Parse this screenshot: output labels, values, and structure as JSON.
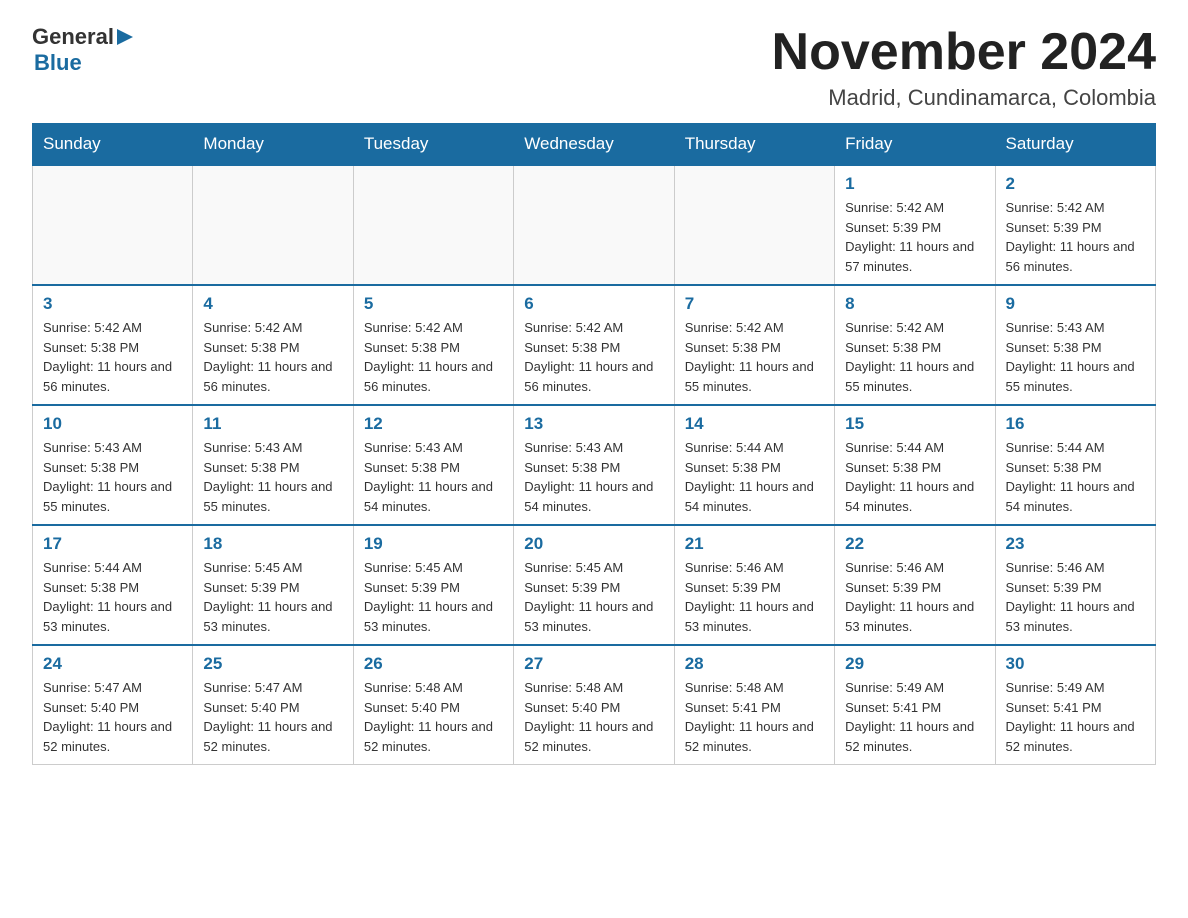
{
  "header": {
    "logo_general": "General",
    "logo_blue": "Blue",
    "title": "November 2024",
    "subtitle": "Madrid, Cundinamarca, Colombia"
  },
  "days_of_week": [
    "Sunday",
    "Monday",
    "Tuesday",
    "Wednesday",
    "Thursday",
    "Friday",
    "Saturday"
  ],
  "weeks": [
    [
      {
        "day": "",
        "info": ""
      },
      {
        "day": "",
        "info": ""
      },
      {
        "day": "",
        "info": ""
      },
      {
        "day": "",
        "info": ""
      },
      {
        "day": "",
        "info": ""
      },
      {
        "day": "1",
        "info": "Sunrise: 5:42 AM\nSunset: 5:39 PM\nDaylight: 11 hours and 57 minutes."
      },
      {
        "day": "2",
        "info": "Sunrise: 5:42 AM\nSunset: 5:39 PM\nDaylight: 11 hours and 56 minutes."
      }
    ],
    [
      {
        "day": "3",
        "info": "Sunrise: 5:42 AM\nSunset: 5:38 PM\nDaylight: 11 hours and 56 minutes."
      },
      {
        "day": "4",
        "info": "Sunrise: 5:42 AM\nSunset: 5:38 PM\nDaylight: 11 hours and 56 minutes."
      },
      {
        "day": "5",
        "info": "Sunrise: 5:42 AM\nSunset: 5:38 PM\nDaylight: 11 hours and 56 minutes."
      },
      {
        "day": "6",
        "info": "Sunrise: 5:42 AM\nSunset: 5:38 PM\nDaylight: 11 hours and 56 minutes."
      },
      {
        "day": "7",
        "info": "Sunrise: 5:42 AM\nSunset: 5:38 PM\nDaylight: 11 hours and 55 minutes."
      },
      {
        "day": "8",
        "info": "Sunrise: 5:42 AM\nSunset: 5:38 PM\nDaylight: 11 hours and 55 minutes."
      },
      {
        "day": "9",
        "info": "Sunrise: 5:43 AM\nSunset: 5:38 PM\nDaylight: 11 hours and 55 minutes."
      }
    ],
    [
      {
        "day": "10",
        "info": "Sunrise: 5:43 AM\nSunset: 5:38 PM\nDaylight: 11 hours and 55 minutes."
      },
      {
        "day": "11",
        "info": "Sunrise: 5:43 AM\nSunset: 5:38 PM\nDaylight: 11 hours and 55 minutes."
      },
      {
        "day": "12",
        "info": "Sunrise: 5:43 AM\nSunset: 5:38 PM\nDaylight: 11 hours and 54 minutes."
      },
      {
        "day": "13",
        "info": "Sunrise: 5:43 AM\nSunset: 5:38 PM\nDaylight: 11 hours and 54 minutes."
      },
      {
        "day": "14",
        "info": "Sunrise: 5:44 AM\nSunset: 5:38 PM\nDaylight: 11 hours and 54 minutes."
      },
      {
        "day": "15",
        "info": "Sunrise: 5:44 AM\nSunset: 5:38 PM\nDaylight: 11 hours and 54 minutes."
      },
      {
        "day": "16",
        "info": "Sunrise: 5:44 AM\nSunset: 5:38 PM\nDaylight: 11 hours and 54 minutes."
      }
    ],
    [
      {
        "day": "17",
        "info": "Sunrise: 5:44 AM\nSunset: 5:38 PM\nDaylight: 11 hours and 53 minutes."
      },
      {
        "day": "18",
        "info": "Sunrise: 5:45 AM\nSunset: 5:39 PM\nDaylight: 11 hours and 53 minutes."
      },
      {
        "day": "19",
        "info": "Sunrise: 5:45 AM\nSunset: 5:39 PM\nDaylight: 11 hours and 53 minutes."
      },
      {
        "day": "20",
        "info": "Sunrise: 5:45 AM\nSunset: 5:39 PM\nDaylight: 11 hours and 53 minutes."
      },
      {
        "day": "21",
        "info": "Sunrise: 5:46 AM\nSunset: 5:39 PM\nDaylight: 11 hours and 53 minutes."
      },
      {
        "day": "22",
        "info": "Sunrise: 5:46 AM\nSunset: 5:39 PM\nDaylight: 11 hours and 53 minutes."
      },
      {
        "day": "23",
        "info": "Sunrise: 5:46 AM\nSunset: 5:39 PM\nDaylight: 11 hours and 53 minutes."
      }
    ],
    [
      {
        "day": "24",
        "info": "Sunrise: 5:47 AM\nSunset: 5:40 PM\nDaylight: 11 hours and 52 minutes."
      },
      {
        "day": "25",
        "info": "Sunrise: 5:47 AM\nSunset: 5:40 PM\nDaylight: 11 hours and 52 minutes."
      },
      {
        "day": "26",
        "info": "Sunrise: 5:48 AM\nSunset: 5:40 PM\nDaylight: 11 hours and 52 minutes."
      },
      {
        "day": "27",
        "info": "Sunrise: 5:48 AM\nSunset: 5:40 PM\nDaylight: 11 hours and 52 minutes."
      },
      {
        "day": "28",
        "info": "Sunrise: 5:48 AM\nSunset: 5:41 PM\nDaylight: 11 hours and 52 minutes."
      },
      {
        "day": "29",
        "info": "Sunrise: 5:49 AM\nSunset: 5:41 PM\nDaylight: 11 hours and 52 minutes."
      },
      {
        "day": "30",
        "info": "Sunrise: 5:49 AM\nSunset: 5:41 PM\nDaylight: 11 hours and 52 minutes."
      }
    ]
  ]
}
